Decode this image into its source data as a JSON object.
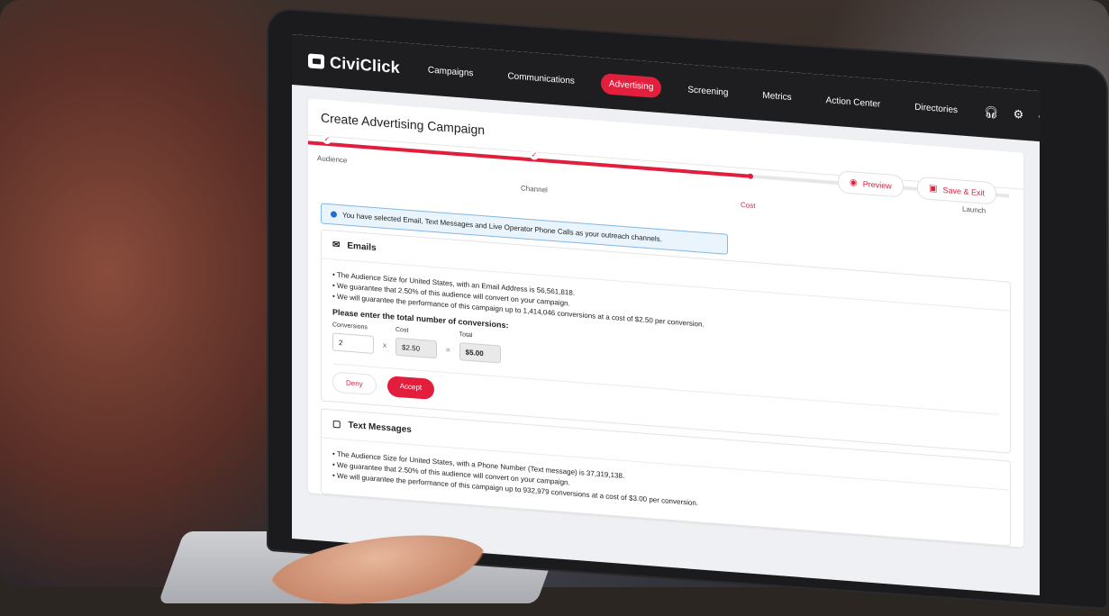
{
  "nav": {
    "brand": "CiviClick",
    "items": [
      {
        "label": "Campaigns"
      },
      {
        "label": "Communications"
      },
      {
        "label": "Advertising",
        "active": true
      },
      {
        "label": "Screening"
      },
      {
        "label": "Metrics"
      },
      {
        "label": "Action Center"
      },
      {
        "label": "Directories"
      }
    ],
    "icons": [
      "headset-icon",
      "gear-icon",
      "user-icon"
    ]
  },
  "page": {
    "title": "Create Advertising Campaign",
    "preview_label": "Preview",
    "save_exit_label": "Save & Exit"
  },
  "stepper": {
    "steps": [
      {
        "label": "Audience",
        "state": "done"
      },
      {
        "label": "Channel",
        "state": "done"
      },
      {
        "label": "Cost",
        "state": "current"
      },
      {
        "label": "Launch",
        "state": "future"
      }
    ]
  },
  "info": {
    "text": "You have selected Email, Text Messages and Live Operator Phone Calls as your outreach channels."
  },
  "emails": {
    "title": "Emails",
    "bullets": [
      "The Audience Size for United States, with an Email Address is 56,561,818.",
      "We guarantee that 2.50% of this audience will convert on your campaign.",
      "We will guarantee the performance of this campaign up to 1,414,046 conversions at a cost of $2.50 per conversion."
    ],
    "prompt": "Please enter the total number of conversions:",
    "conversions_label": "Conversions",
    "conversions_value": "2",
    "multiply": "x",
    "cost_label": "Cost",
    "cost_value": "$2.50",
    "equals": "=",
    "total_label": "Total",
    "total_value": "$5.00",
    "deny_label": "Deny",
    "accept_label": "Accept"
  },
  "text_messages": {
    "title": "Text Messages",
    "bullets": [
      "The Audience Size for United States, with a Phone Number (Text message) is 37,319,138.",
      "We guarantee that 2.50% of this audience will convert on your campaign.",
      "We will guarantee the performance of this campaign up to 932,979 conversions at a cost of $3.00 per conversion."
    ]
  },
  "colors": {
    "accent": "#e31e3d",
    "nav_bg": "#1e1e20",
    "info_border": "#7fb7e6"
  }
}
